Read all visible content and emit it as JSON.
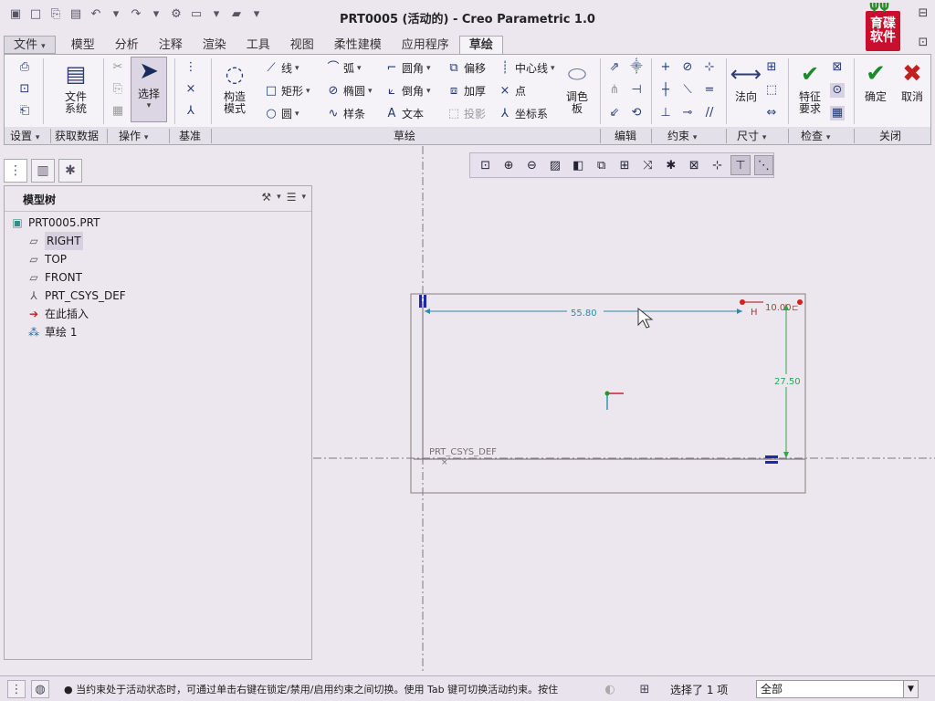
{
  "window": {
    "title": "PRT0005 (活动的) - Creo Parametric 1.0"
  },
  "logo": {
    "text": "育碟软件"
  },
  "tabs": [
    "文件",
    "模型",
    "分析",
    "注释",
    "渲染",
    "工具",
    "视图",
    "柔性建模",
    "应用程序",
    "草绘"
  ],
  "ribbon": {
    "file_system": "文件\n系统",
    "file_system_l1": "文件",
    "file_system_l2": "系统",
    "select": "选择",
    "construct_l1": "构造",
    "construct_l2": "模式",
    "sketch": {
      "line": "线",
      "arc": "弧",
      "fillet": "圆角",
      "offset": "偏移",
      "centerline": "中心线",
      "rect": "矩形",
      "ellipse": "椭圆",
      "chamfer": "倒角",
      "thicken": "加厚",
      "point": "点",
      "circle": "圆",
      "spline": "样条",
      "text": "文本",
      "project": "投影",
      "csys": "坐标系"
    },
    "palette_l1": "调色",
    "palette_l2": "板",
    "normal": "法向",
    "feature_req_l1": "特征",
    "feature_req_l2": "要求",
    "ok": "确定",
    "cancel": "取消"
  },
  "groups": [
    "设置",
    "获取数据",
    "操作",
    "基准",
    "草绘",
    "编辑",
    "约束",
    "尺寸",
    "检查",
    "关闭"
  ],
  "panel": {
    "title": "模型树",
    "tree": [
      {
        "label": "PRT0005.PRT",
        "icon": "part-icon"
      },
      {
        "label": "RIGHT",
        "icon": "plane-icon",
        "selected": true
      },
      {
        "label": "TOP",
        "icon": "plane-icon"
      },
      {
        "label": "FRONT",
        "icon": "plane-icon"
      },
      {
        "label": "PRT_CSYS_DEF",
        "icon": "csys-icon"
      },
      {
        "label": "在此插入",
        "icon": "insert-arrow-icon"
      },
      {
        "label": "草绘 1",
        "icon": "sketch-icon"
      }
    ]
  },
  "canvas": {
    "dims": {
      "horizontal": "55.80",
      "width": "10.00",
      "height": "27.50"
    },
    "csys_label": "PRT_CSYS_DEF",
    "h_constraint": "H"
  },
  "status": {
    "message": "● 当约束处于活动状态时，可通过单击右键在锁定/禁用/启用约束之间切换。使用 Tab 键可切换活动约束。按住",
    "selection": "选择了 1 项",
    "filter": "全部"
  },
  "colors": {
    "accent": "#223a7a",
    "dim_color": "#2f8aa6",
    "red": "#c02020",
    "green": "#1a8a2a"
  }
}
